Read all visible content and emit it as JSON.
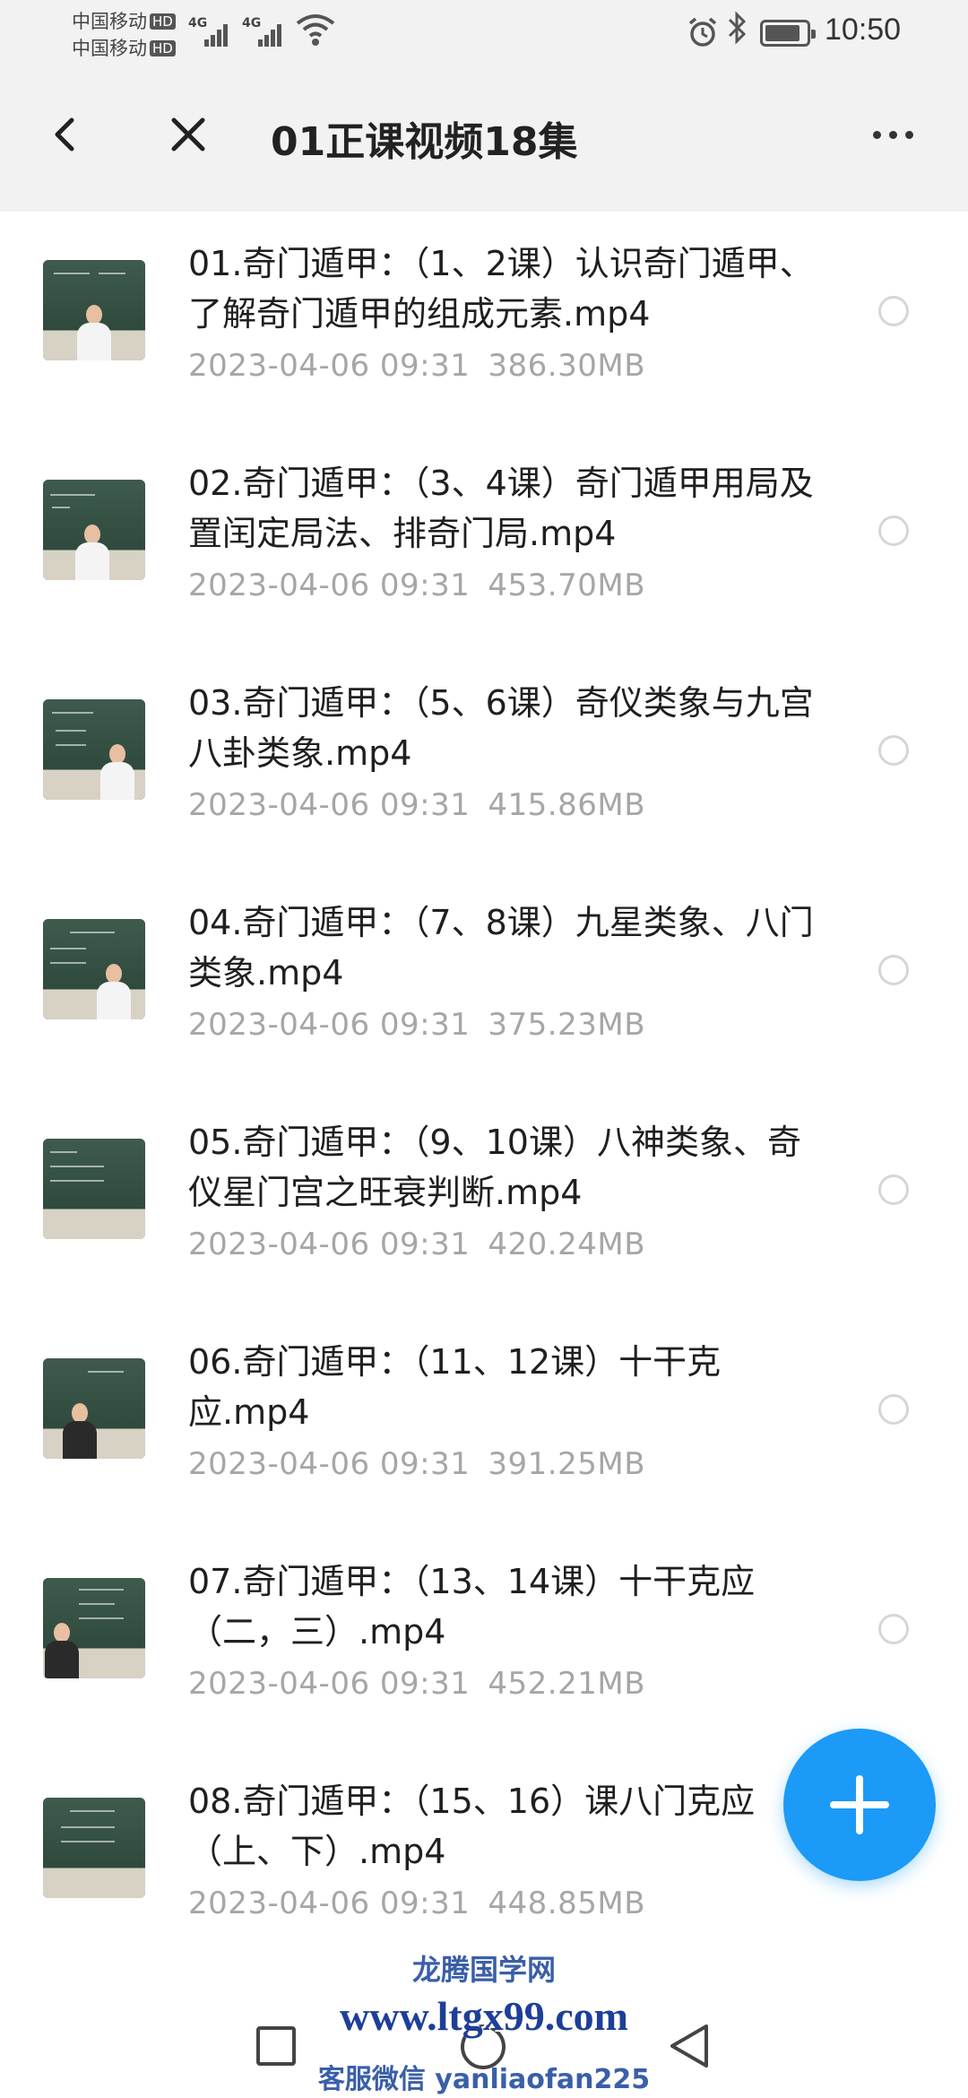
{
  "status_bar": {
    "carrier_1": "中国移动",
    "carrier_2": "中国移动",
    "hd_1": "HD",
    "hd_2": "HD",
    "net_1": "4G",
    "net_2": "4G",
    "time": "10:50",
    "icons": [
      "signal-icon",
      "wifi-icon",
      "alarm-icon",
      "bluetooth-icon",
      "battery-icon"
    ]
  },
  "header": {
    "title": "01正课视频18集",
    "back_icon": "back-arrow-icon",
    "close_icon": "close-icon",
    "more_icon": "more-icon"
  },
  "files": [
    {
      "name": "01.奇门遁甲：（1、2课）认识奇门遁甲、了解奇门遁甲的组成元素.mp4",
      "date": "2023-04-06  09:31",
      "size": "386.30MB"
    },
    {
      "name": "02.奇门遁甲：（3、4课）奇门遁甲用局及置闰定局法、排奇门局.mp4",
      "date": "2023-04-06  09:31",
      "size": "453.70MB"
    },
    {
      "name": "03.奇门遁甲：（5、6课）奇仪类象与九宫八卦类象.mp4",
      "date": "2023-04-06  09:31",
      "size": "415.86MB"
    },
    {
      "name": "04.奇门遁甲：（7、8课）九星类象、八门类象.mp4",
      "date": "2023-04-06  09:31",
      "size": "375.23MB"
    },
    {
      "name": "05.奇门遁甲：（9、10课）八神类象、奇仪星门宫之旺衰判断.mp4",
      "date": "2023-04-06  09:31",
      "size": "420.24MB"
    },
    {
      "name": "06.奇门遁甲：（11、12课）十干克应.mp4",
      "date": "2023-04-06  09:31",
      "size": "391.25MB"
    },
    {
      "name": "07.奇门遁甲：（13、14课）十干克应（二，三）.mp4",
      "date": "2023-04-06  09:31",
      "size": "452.21MB"
    },
    {
      "name": "08.奇门遁甲：（15、16）课八门克应（上、下）.mp4",
      "date": "2023-04-06  09:31",
      "size": "448.85MB"
    }
  ],
  "fab": {
    "icon": "plus-icon"
  },
  "watermark": {
    "line_1": "龙腾国学网",
    "line_2": "www.ltgx99.com",
    "line_3": "客服微信 yanliaofan225"
  },
  "navbar": {
    "icons": [
      "recent-apps-icon",
      "home-icon",
      "back-icon"
    ]
  },
  "colors": {
    "accent": "#1b9af7",
    "header_bg": "#f2f2f2",
    "meta_text": "#a6a6a6"
  }
}
